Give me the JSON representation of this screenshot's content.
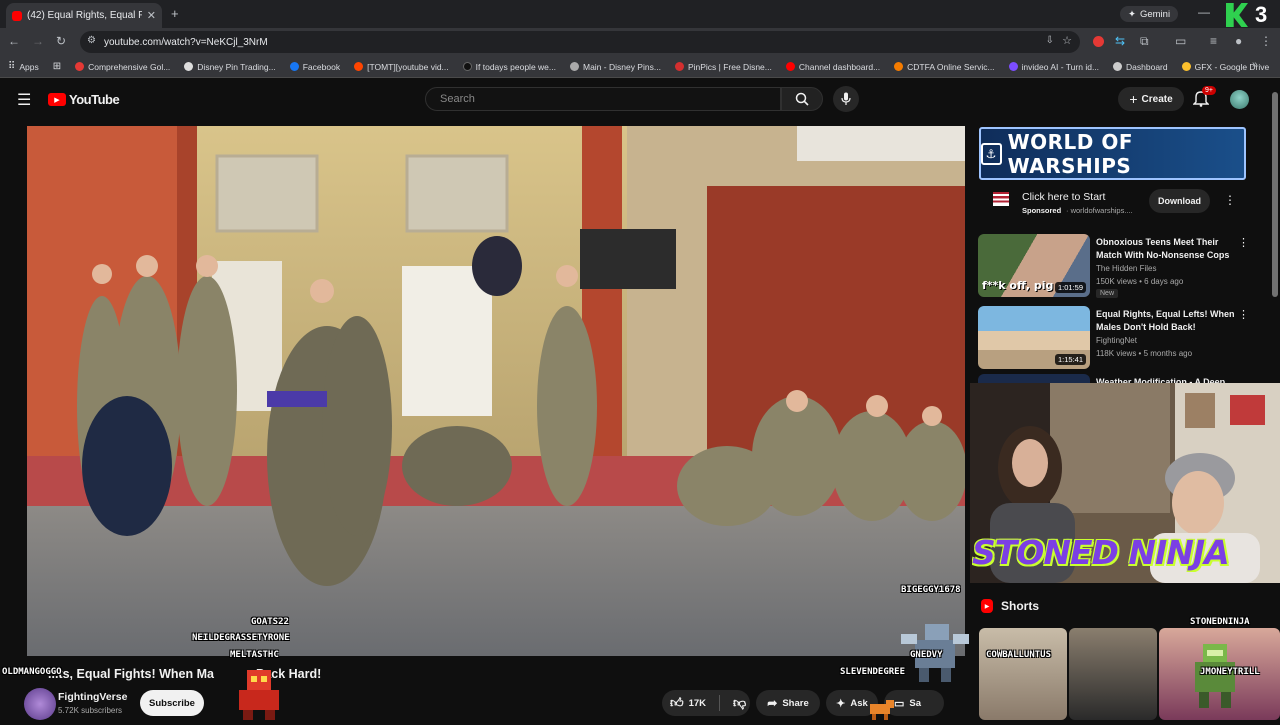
{
  "browser": {
    "tab_title": "(42) Equal Rights, Equal Fig",
    "url": "youtube.com/watch?v=NeKCjl_3NrM",
    "gemini_label": "Gemini",
    "bookmarks": [
      "Apps",
      "Comprehensive Gol...",
      "Disney Pin Trading...",
      "Facebook",
      "[TOMT][youtube vid...",
      "If todays people we...",
      "Main - Disney Pins...",
      "PinPics | Free Disne...",
      "Channel dashboard...",
      "CDTFA Online Servic...",
      "invideo AI - Turn id...",
      "Dashboard",
      "GFX - Google Drive"
    ]
  },
  "header": {
    "logo_text": "YouTube",
    "search_placeholder": "Search",
    "create_label": "Create",
    "notif_badge": "9+"
  },
  "ad": {
    "banner_text": "WORLD OF WARSHIPS",
    "title": "Click here to Start",
    "sponsored": "Sponsored",
    "domain": "· worldofwarships....",
    "download_label": "Download"
  },
  "recommendations": [
    {
      "title": "Obnoxious Teens Meet Their Match With No-Nonsense Cops",
      "channel": "The Hidden Files",
      "meta": "150K views • 6 days ago",
      "badge": "New",
      "duration": "1:01:59",
      "thumb_caption": "f**k off, pig"
    },
    {
      "title": "Equal Rights, Equal Lefts! When Males Don't Hold Back!",
      "channel": "FightingNet",
      "meta": "118K views • 5 months ago",
      "duration": "1:15:41"
    },
    {
      "title": "Weather Modification - A Deep"
    }
  ],
  "video": {
    "title_visible_start": "...ts, Equal Fights! When Ma",
    "title_visible_end": "Pack Hard!",
    "channel": "FightingVerse",
    "subscribers": "5.72K subscribers",
    "subscribe_label": "Subscribe",
    "likes": "17K",
    "share_label": "Share",
    "ask_label": "Ask",
    "save_label": "Sa"
  },
  "stream_overlay": {
    "webcam_banner": "STONED NINJA",
    "usernames": [
      "BIGEGGY1678",
      "GOATS22",
      "NEILDEGRASSETYRONE",
      "MELTASTHC",
      "OLDMANGOGGO",
      "SLEVENDEGREE",
      "GNEDVY",
      "COWBALLUNTUS",
      "STONEDNINJA",
      "JMONEYTRILL"
    ]
  },
  "shorts": {
    "label": "Shorts"
  },
  "colors": {
    "brand_red": "#ff0000",
    "bg": "#0f0f0f",
    "webcam_text": "#7b3fe4"
  }
}
